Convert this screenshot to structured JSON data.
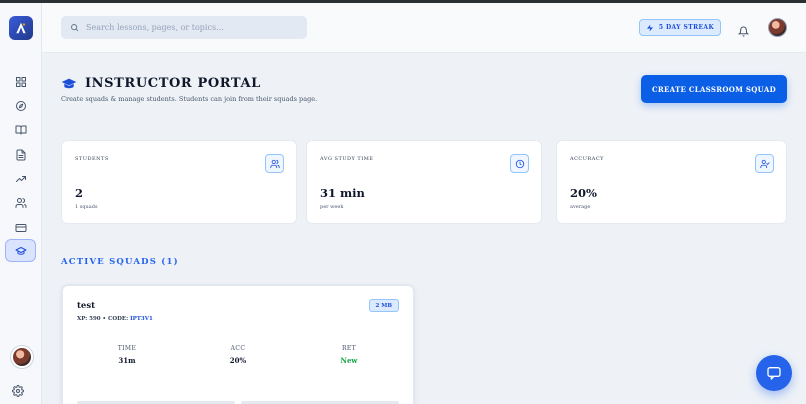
{
  "search": {
    "placeholder": "Search lessons, pages, or topics..."
  },
  "header": {
    "streak_label": "5 DAY STREAK"
  },
  "page": {
    "title": "INSTRUCTOR PORTAL",
    "subtitle": "Create squads & manage students. Students can join from their squads page.",
    "create_button": "CREATE CLASSROOM SQUAD"
  },
  "stats": [
    {
      "label": "STUDENTS",
      "value": "2",
      "sub": "1 squads",
      "icon": "users-icon"
    },
    {
      "label": "AVG STUDY TIME",
      "value": "31 min",
      "sub": "per week",
      "icon": "clock-icon"
    },
    {
      "label": "ACCURACY",
      "value": "20%",
      "sub": "average",
      "icon": "user-check-icon"
    }
  ],
  "squads_section": {
    "title": "ACTIVE SQUADS (1)"
  },
  "squad": {
    "name": "test",
    "meta_prefix": "XP: 590 • CODE:",
    "code": "IPT3V1",
    "badge": "2 MB",
    "time_label": "TIME",
    "time_value": "31m",
    "acc_label": "ACC",
    "acc_value": "20%",
    "ret_label": "RET",
    "ret_value": "New"
  },
  "sidebar": {
    "items": [
      "grid-icon",
      "compass-icon",
      "book-icon",
      "document-icon",
      "trending-icon",
      "users-icon",
      "card-icon",
      "graduation-cap-icon"
    ],
    "active": "graduation-cap-icon"
  },
  "colors": {
    "accent": "#0b5fe6",
    "positive": "#16a34a"
  }
}
